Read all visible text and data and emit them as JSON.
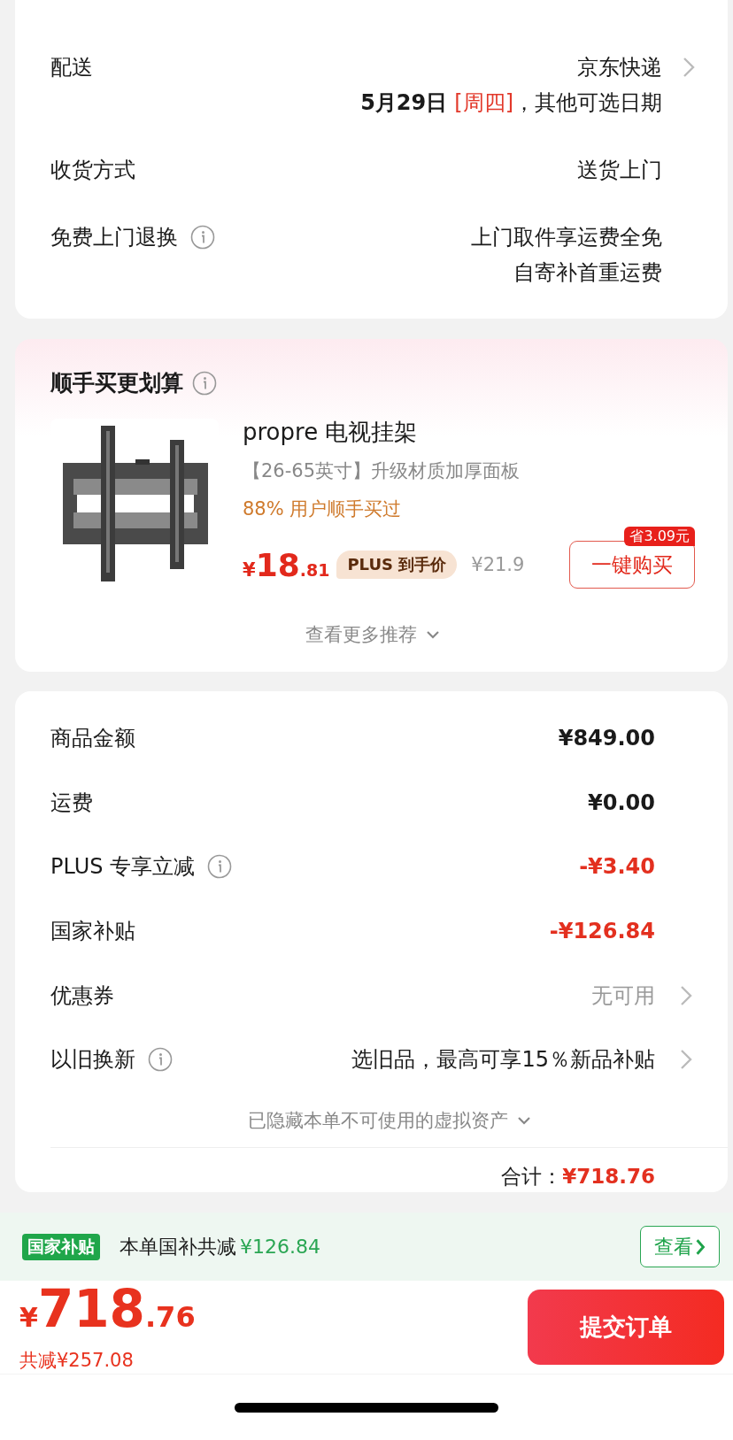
{
  "delivery_card": {
    "rows": [
      {
        "label": "配送",
        "info": false,
        "values": [
          "京东快递"
        ],
        "chevron": true,
        "date_line": {
          "date": "5月29日",
          "weekday": "[周四]",
          "note": "，其他可选日期"
        }
      },
      {
        "label": "收货方式",
        "info": false,
        "values": [
          "送货上门"
        ],
        "chevron": false
      },
      {
        "label": "免费上门退换",
        "info": true,
        "values": [
          "上门取件享运费全免",
          "自寄补首重运费"
        ],
        "chevron": false
      }
    ]
  },
  "addon_card": {
    "title": "顺手买更划算",
    "info": true,
    "product": {
      "kind": "picture",
      "name": "propre 电视挂架",
      "spec": "【26-65英寸】升级材质加厚面板",
      "social": "88% 用户顺手买过",
      "price_symbol": "¥",
      "price_int": "18",
      "price_dec": ".81",
      "price_tag": "PLUS 到手价",
      "original_price": "¥21.9",
      "save_badge": "省3.09元",
      "buy_button": "一键购买"
    },
    "more": "查看更多推荐"
  },
  "summary_card": {
    "rows": [
      {
        "label": "商品金额",
        "info": false,
        "value": "¥849.00",
        "kind": "amount",
        "chevron": false
      },
      {
        "label": "运费",
        "info": false,
        "value": "¥0.00",
        "kind": "amount",
        "chevron": false
      },
      {
        "label": "PLUS 专享立减",
        "info": true,
        "value": "-¥3.40",
        "kind": "discount",
        "chevron": false
      },
      {
        "label": "国家补贴",
        "info": false,
        "value": "-¥126.84",
        "kind": "discount",
        "chevron": false
      },
      {
        "label": "优惠券",
        "info": false,
        "value": "无可用",
        "kind": "muted",
        "chevron": true
      },
      {
        "label": "以旧换新",
        "info": true,
        "value": "选旧品，最高可享15％新品补贴",
        "kind": "plain",
        "chevron": true
      }
    ],
    "hidden_assets": "已隐藏本单不可使用的虚拟资产",
    "total_label": "合计：",
    "total": "¥718.76"
  },
  "subsidy_bar": {
    "badge": "国家补贴",
    "text": "本单国补共减",
    "amount": "¥126.84",
    "button": "查看"
  },
  "footer": {
    "price_symbol": "¥",
    "price_int": "718",
    "price_dec": ".76",
    "saved": "共减¥257.08",
    "submit": "提交订单"
  }
}
